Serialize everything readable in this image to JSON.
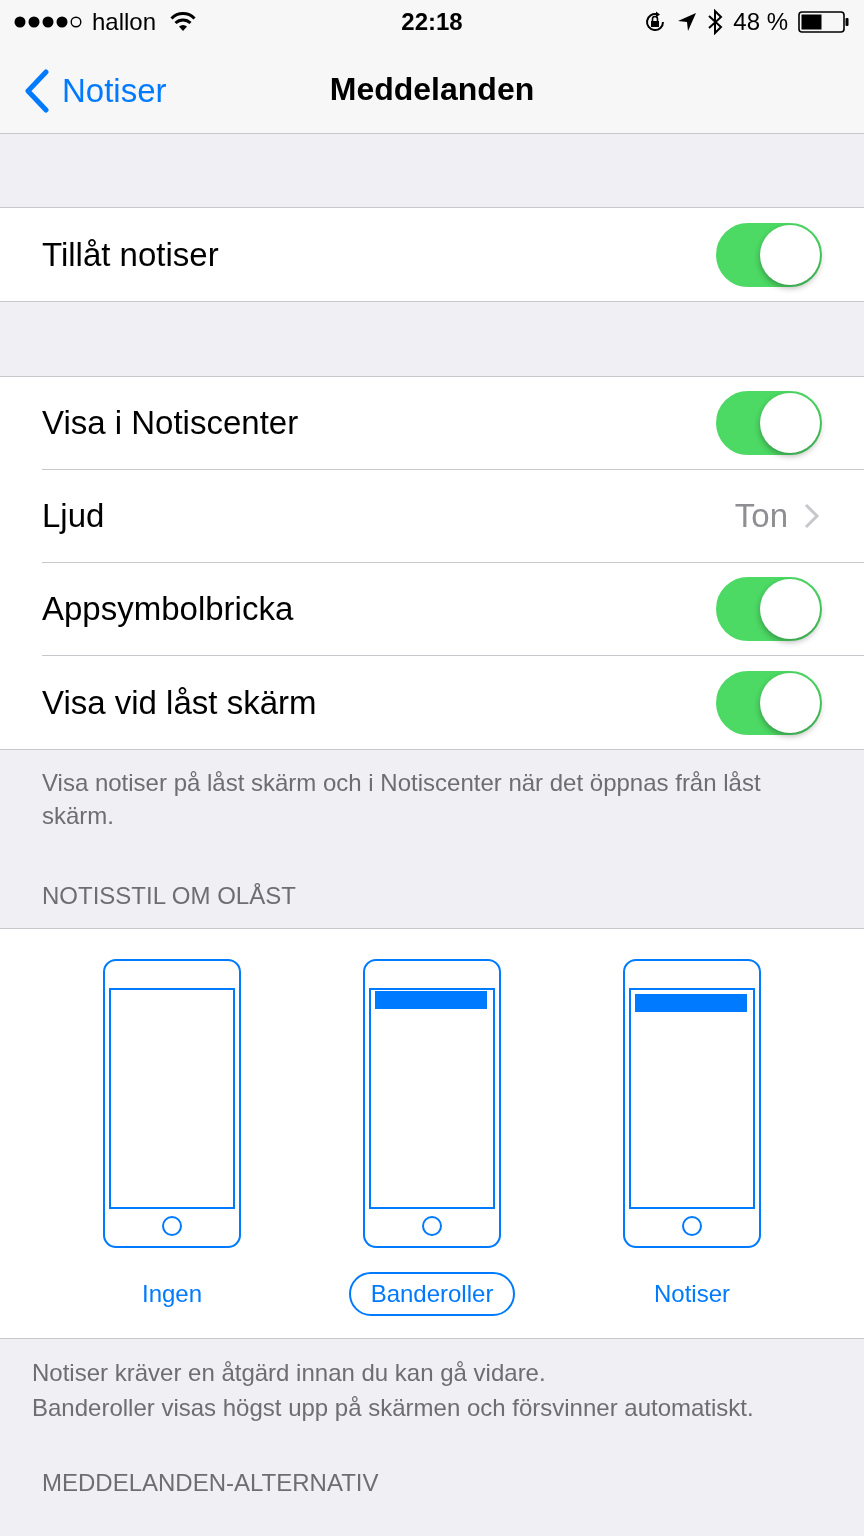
{
  "status_bar": {
    "carrier": "hallon",
    "time": "22:18",
    "battery": "48 %"
  },
  "nav": {
    "back": "Notiser",
    "title": "Meddelanden"
  },
  "groups": [
    {
      "rows": [
        {
          "kind": "switch",
          "label": "Tillåt notiser",
          "on": true
        }
      ]
    },
    {
      "rows": [
        {
          "kind": "switch",
          "label": "Visa i Notiscenter",
          "on": true
        },
        {
          "kind": "value",
          "label": "Ljud",
          "value": "Ton"
        },
        {
          "kind": "switch",
          "label": "Appsymbolbricka",
          "on": true
        },
        {
          "kind": "switch",
          "label": "Visa vid låst skärm",
          "on": true
        }
      ],
      "footer": "Visa notiser på låst skärm och i Notiscenter när det öppnas från låst skärm."
    }
  ],
  "style_section": {
    "header": "NOTISSTIL OM OLÅST",
    "options": [
      {
        "kind": "none",
        "label": "Ingen",
        "selected": false
      },
      {
        "kind": "banner",
        "label": "Banderoller",
        "selected": true
      },
      {
        "kind": "alert",
        "label": "Notiser",
        "selected": false
      }
    ],
    "footer": [
      "Notiser kräver en åtgärd innan du kan gå vidare.",
      "Banderoller visas högst upp på skärmen och försvinner automatiskt."
    ]
  },
  "next_header": "MEDDELANDEN-ALTERNATIV"
}
